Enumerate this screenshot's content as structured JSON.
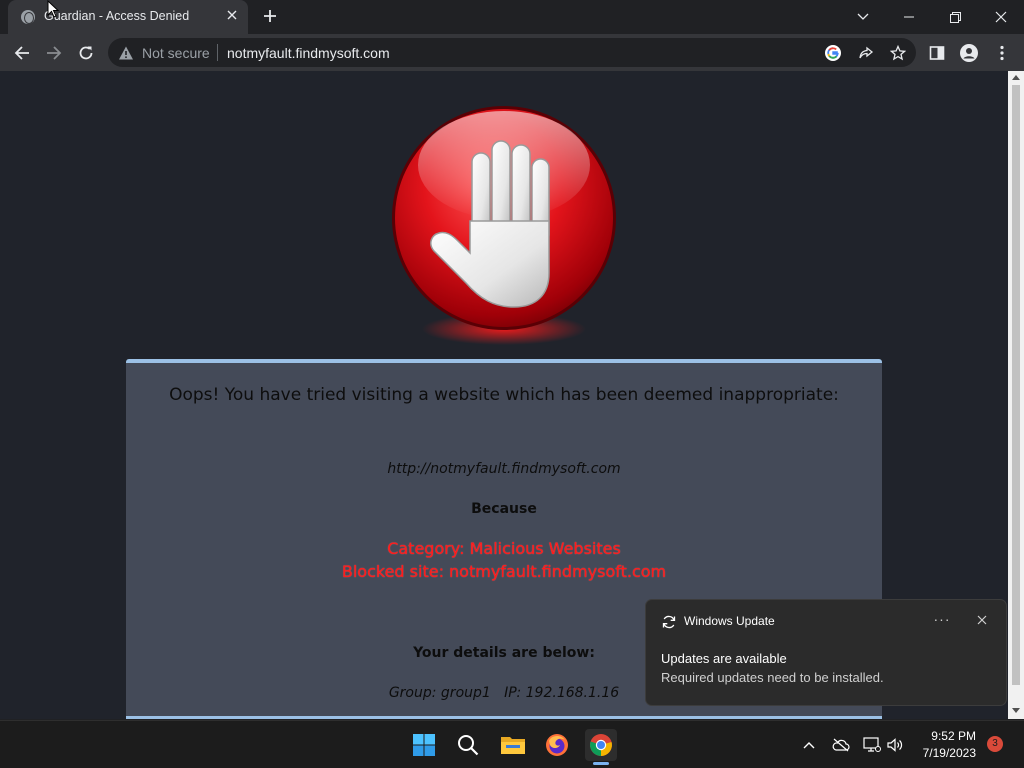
{
  "browser": {
    "tab_title": "Guardian - Access Denied",
    "omnibox": {
      "security_label": "Not secure",
      "url": "notmyfault.findmysoft.com"
    }
  },
  "page": {
    "heading": "Oops! You have tried visiting a website which has been deemed inappropriate:",
    "blocked_url": "http://notmyfault.findmysoft.com",
    "because_label": "Because",
    "category_line": "Category: Malicious Websites",
    "blocked_site_line": "Blocked site: notmyfault.findmysoft.com",
    "details_label": "Your details are below:",
    "group_ip_line": "Group: group1   IP: 192.168.1.16",
    "colors": {
      "panel": "#444a58",
      "accent_border": "#9cc1e6",
      "alert_red": "#ff1a1a",
      "stop_sign": "#d9141a"
    }
  },
  "notification": {
    "app_name": "Windows Update",
    "headline": "Updates are available",
    "body": "Required updates need to be installed.",
    "more_glyph": "···"
  },
  "taskbar": {
    "apps": [
      "start-icon",
      "search-icon",
      "file-explorer-icon",
      "firefox-icon",
      "chrome-icon"
    ],
    "clock_time": "9:52 PM",
    "clock_date": "7/19/2023",
    "notification_count": "3"
  }
}
